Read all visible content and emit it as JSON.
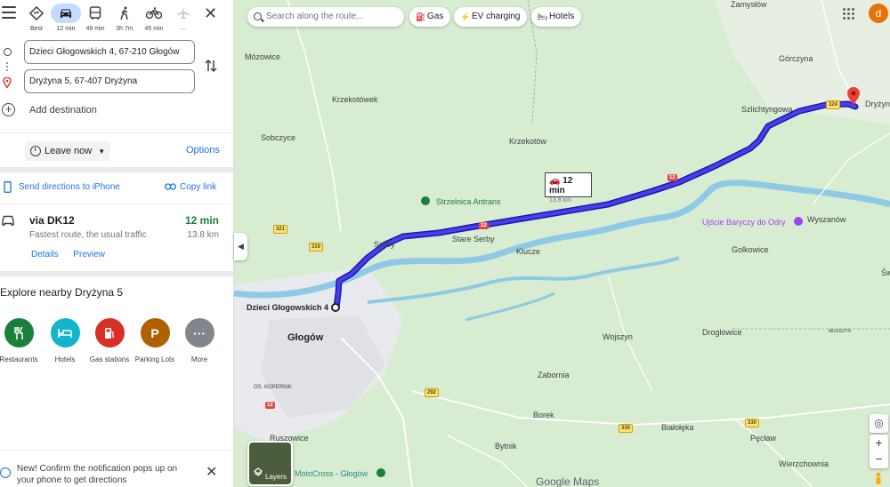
{
  "panel": {
    "modes": [
      {
        "name": "best",
        "label": "Best"
      },
      {
        "name": "driving",
        "label": "12 min"
      },
      {
        "name": "transit",
        "label": "49 min"
      },
      {
        "name": "walking",
        "label": "3h 7m"
      },
      {
        "name": "cycling",
        "label": "45 min"
      },
      {
        "name": "flights",
        "label": "—"
      }
    ],
    "origin": "Dzieci Głogowskich 4, 67-210 Głogów",
    "destination": "Dryżyna 5, 67-407 Dryżyna",
    "add_destination": "Add destination",
    "leave_now": "Leave now",
    "options": "Options",
    "send_directions": "Send directions to iPhone",
    "copy_link": "Copy link",
    "route": {
      "via": "via DK12",
      "description": "Fastest route, the usual traffic",
      "time": "12 min",
      "distance": "13.8 km",
      "details": "Details",
      "preview": "Preview"
    },
    "explore_title": "Explore nearby Dryżyna 5",
    "categories": [
      {
        "label": "Restaurants",
        "color": "#188038"
      },
      {
        "label": "Hotels",
        "color": "#12b5cb"
      },
      {
        "label": "Gas stations",
        "color": "#d93025"
      },
      {
        "label": "Parking Lots",
        "color": "#b06000"
      },
      {
        "label": "More",
        "color": "#80868b"
      }
    ],
    "notification": "New! Confirm the notification pops up on your phone to get directions"
  },
  "map": {
    "search_placeholder": "Search along the route...",
    "chips": [
      "Gas",
      "EV charging",
      "Hotels"
    ],
    "avatar_letter": "d",
    "route_time": "12 min",
    "route_distance": "13,8 km",
    "layers": "Layers",
    "google": "Google Maps",
    "labels": {
      "zamyslow": "Zamysłów",
      "gorczyna": "Górczyna",
      "mozowice": "Mózowice",
      "krzekotowek": "Krzekotówek",
      "szlichtyngowa": "Szlichtyngowa",
      "dryzyna": "Dryżyn",
      "sobczyce": "Sobczyce",
      "krzekotow": "Krzekotów",
      "strzelnica": "Strzelnica Antrans",
      "ujscie": "Ujście Baryczy do Odry",
      "wyszanow": "Wyszanów",
      "serby": "Serby",
      "stare_serby": "Stare Serby",
      "klucze": "Klucze",
      "golkowice": "Golkowice",
      "sw": "Św",
      "dzieci": "Dzieci Głogowskich 4",
      "glogow": "Głogów",
      "wojszyn": "Wojszyn",
      "droglowice": "Droglowice",
      "kopernik": "OS. KOPERNIK",
      "zabornia": "Zabornia",
      "borek": "Borek",
      "bialoleka": "Białołęka",
      "peclaw": "Pęcław",
      "ruszowice": "Ruszowice",
      "bytnik": "Bytnik",
      "motocross": "MotoCross - Głogów",
      "wierzchownia": "Wierzchownia",
      "mileszyn": "MILESZYN"
    },
    "shields": {
      "r12a": "12",
      "r12b": "12",
      "r12c": "12",
      "r12d": "12",
      "r321": "321",
      "r319": "319",
      "r292": "292",
      "r330a": "330",
      "r330b": "330",
      "r324": "324"
    }
  }
}
